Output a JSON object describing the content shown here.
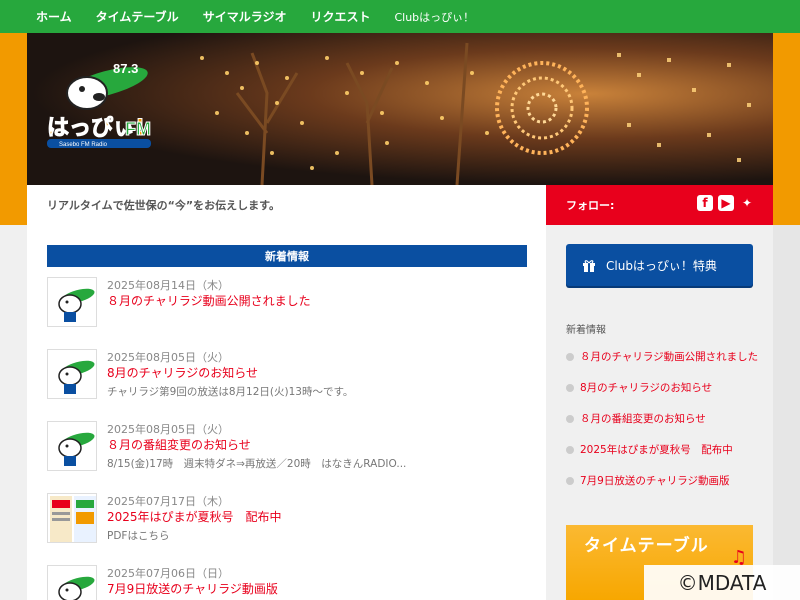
{
  "nav": {
    "items": [
      "ホーム",
      "タイムテーブル",
      "サイマルラジオ",
      "リクエスト",
      "Clubはっぴぃ！"
    ]
  },
  "banner": {
    "logo_main": "はっぴぃ!",
    "logo_fm": "FM",
    "logo_freq": "87.3",
    "logo_sub": "Sasebo FM Radio"
  },
  "tagline": "リアルタイムで佐世保の“今”をお伝えします。",
  "follow": {
    "label": "フォロー:",
    "icons": [
      "facebook-icon",
      "youtube-icon",
      "twitter-icon"
    ]
  },
  "news": {
    "header": "新着情報",
    "posts": [
      {
        "date": "2025年08月14日（木）",
        "title": "８月のチャリラジ動画公開されました",
        "excerpt": "",
        "thumb": "mascot"
      },
      {
        "date": "2025年08月05日（火）",
        "title": "8月のチャリラジのお知らせ",
        "excerpt": "チャリラジ第9回の放送は8月12日(火)13時～です。",
        "thumb": "mascot"
      },
      {
        "date": "2025年08月05日（火）",
        "title": "８月の番組変更のお知らせ",
        "excerpt": "8/15(金)17時　週末特ダネ⇒再放送／20時　はなきんRADIO...",
        "thumb": "mascot"
      },
      {
        "date": "2025年07月17日（木）",
        "title": "2025年はぴまが夏秋号　配布中",
        "excerpt": "PDFはこちら",
        "thumb": "magazine"
      },
      {
        "date": "2025年07月06日（日）",
        "title": "7月9日放送のチャリラジ動画版",
        "excerpt": "",
        "thumb": "mascot"
      }
    ]
  },
  "sidebar": {
    "club_button": "Clubはっぴぃ！特典",
    "recent_title": "新着情報",
    "recent": [
      "８月のチャリラジ動画公開されました",
      "8月のチャリラジのお知らせ",
      "８月の番組変更のお知らせ",
      "2025年はぴまが夏秋号　配布中",
      "7月9日放送のチャリラジ動画版"
    ],
    "timetable_banner": "タイムテーブル"
  },
  "watermark": "©MDATA",
  "colors": {
    "nav_green": "#27a83d",
    "side_orange": "#f29a00",
    "accent_red": "#e8001c",
    "header_blue": "#0a4fa1"
  }
}
